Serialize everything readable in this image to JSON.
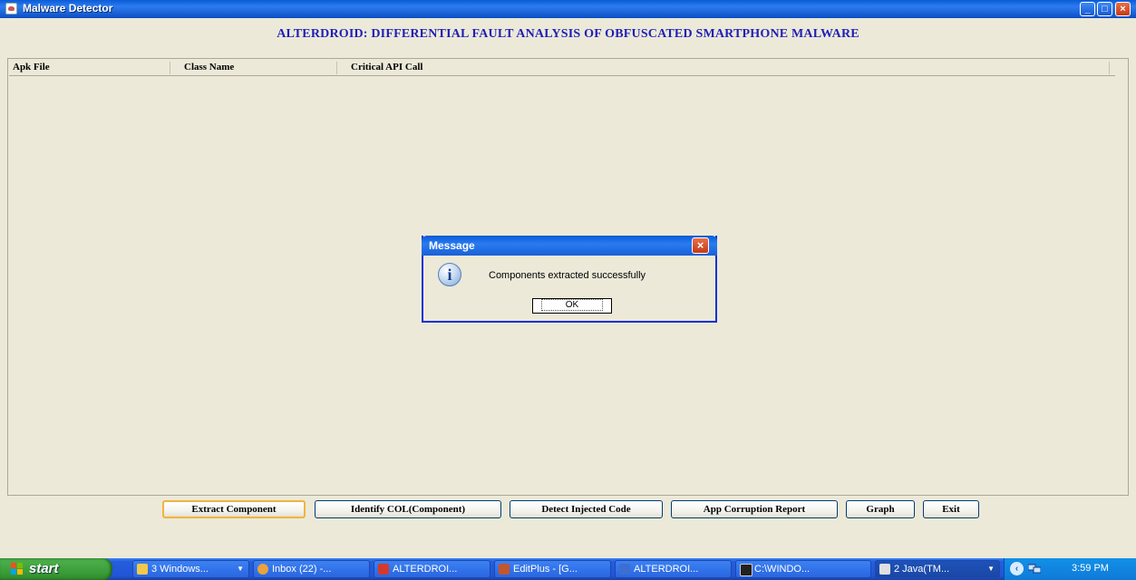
{
  "window": {
    "title": "Malware Detector",
    "controls": {
      "minimize": "_",
      "maximize": "□",
      "close": "×"
    }
  },
  "heading": "ALTERDROID: DIFFERENTIAL FAULT ANALYSIS OF OBFUSCATED SMARTPHONE MALWARE",
  "table": {
    "columns": [
      "Apk File",
      "Class Name",
      "Critical API Call"
    ],
    "rows": []
  },
  "buttons": {
    "extract": "Extract Component",
    "identify": "Identify COL(Component)",
    "detect": "Detect Injected Code",
    "report": "App Corruption Report",
    "graph": "Graph",
    "exit": "Exit"
  },
  "dialog": {
    "title": "Message",
    "icon": "information-icon",
    "message": "Components extracted successfully",
    "ok": "OK"
  },
  "taskbar": {
    "start": "start",
    "items": [
      {
        "label": "3 Windows...",
        "icon": "folder-icon",
        "color": "#f3c94b"
      },
      {
        "label": "Inbox (22) -...",
        "icon": "chrome-icon",
        "color": "#e8a33c"
      },
      {
        "label": "ALTERDROI...",
        "icon": "pdf-icon",
        "color": "#d33a2c"
      },
      {
        "label": "EditPlus - [G...",
        "icon": "editplus-icon",
        "color": "#c4562e"
      },
      {
        "label": "ALTERDROI...",
        "icon": "word-icon",
        "color": "#3d6fd0"
      },
      {
        "label": "C:\\WINDO...",
        "icon": "cmd-icon",
        "color": "#222222"
      },
      {
        "label": "2 Java(TM...",
        "icon": "java-icon",
        "color": "#e0e0e0"
      }
    ],
    "clock": "3:59 PM"
  },
  "colors": {
    "accent_blue": "#1F1FB8",
    "window_bg": "#ECE9D8",
    "titlebar_blue": "#0A5BD6",
    "taskbar_blue": "#245EDB",
    "start_green": "#3C9E3A"
  }
}
